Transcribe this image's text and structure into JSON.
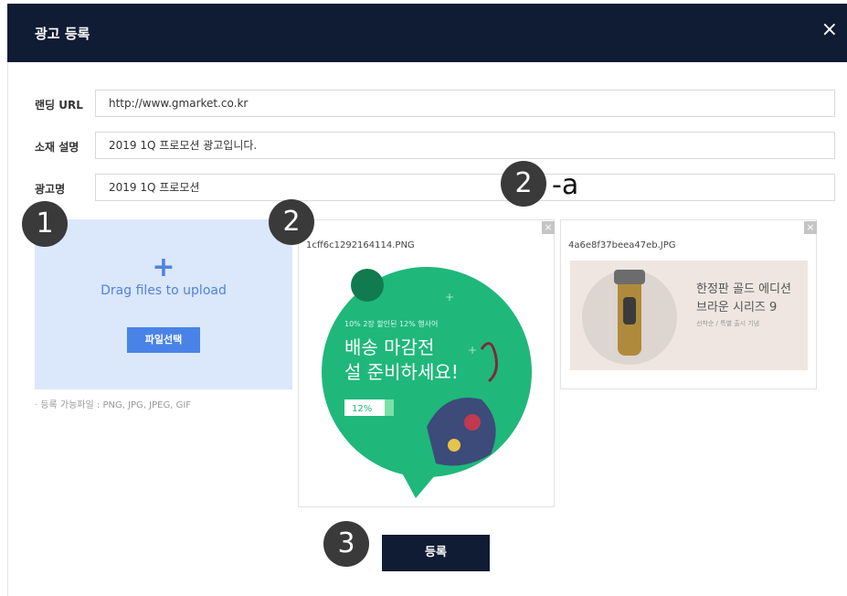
{
  "dialog": {
    "title": "광고 등록",
    "close_glyph": "×"
  },
  "form": {
    "landing_url": {
      "label": "랜딩 URL",
      "value": "http://www.gmarket.co.kr"
    },
    "material_desc": {
      "label": "소재 설명",
      "value": "2019 1Q 프로모션 광고입니다."
    },
    "ad_name": {
      "label": "광고명",
      "value": "2019 1Q 프로모션"
    }
  },
  "upload": {
    "plus": "+",
    "text": "Drag files to upload",
    "button_label": "파일선택",
    "note": "· 등록 가능파일 : PNG, JPG, JPEG, GIF"
  },
  "files": [
    {
      "filename": "1cff6c1292164114.PNG",
      "remove_glyph": "×",
      "ad": {
        "small": "10% 2장 할인된 12% 행사어",
        "line1": "배송 마감전",
        "line2": "설 준비하세요!",
        "tag": "12%"
      }
    },
    {
      "filename": "4a6e8f37beea47eb.JPG",
      "remove_glyph": "×",
      "ad": {
        "line1": "한정판 골드 에디션",
        "line2": "브라운 시리즈 9",
        "small": "선착순 / 특별 출시 기념"
      }
    }
  ],
  "submit_label": "등록",
  "callouts": {
    "one": "1",
    "two": "2",
    "two_a_num": "2",
    "two_a_suffix": "-a",
    "three": "3"
  },
  "colors": {
    "header_bg": "#101b34",
    "dropzone_bg": "#dbe7fb",
    "accent_blue": "#4a83e8",
    "ad_green": "#1fb87a"
  }
}
